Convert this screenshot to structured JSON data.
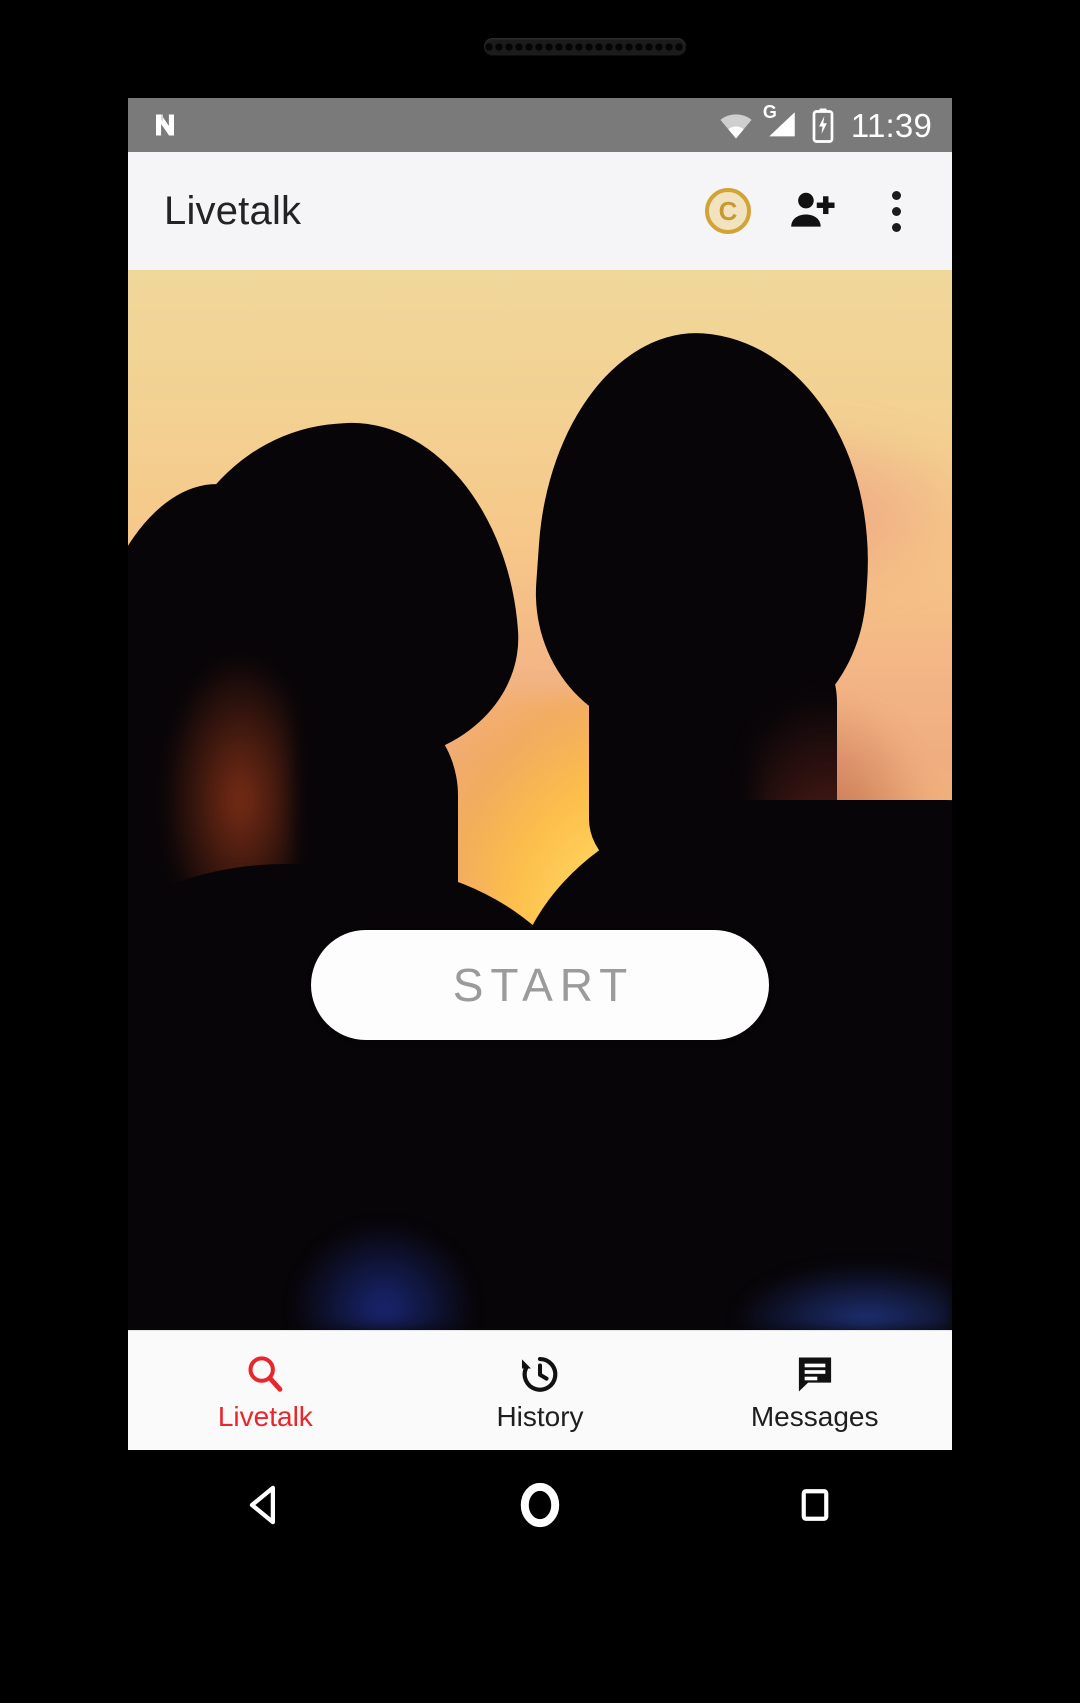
{
  "status_bar": {
    "notification_icon": "android-n-logo-icon",
    "wifi_icon": "wifi-icon",
    "network_label": "G",
    "signal_icon": "cellular-signal-icon",
    "battery_icon": "battery-charging-icon",
    "clock": "11:39",
    "background_color": "#7a7a7a"
  },
  "app_bar": {
    "title": "Livetalk",
    "background_color": "#f5f5f7",
    "actions": [
      {
        "name": "credits-coin-button",
        "icon": "coin-icon",
        "label": "C",
        "color": "#d2a437"
      },
      {
        "name": "add-friend-button",
        "icon": "person-add-icon",
        "label": ""
      },
      {
        "name": "overflow-menu-button",
        "icon": "more-vert-icon",
        "label": ""
      }
    ]
  },
  "hero": {
    "alt": "Silhouette of a couple touching foreheads at sunset",
    "sky_top_color": "#f0d79a",
    "sun_color": "#ffd45f",
    "silhouette_color": "#080508"
  },
  "start_button": {
    "label": "START",
    "text_color": "#9b9b9b",
    "background_color": "#fdfdfd"
  },
  "bottom_nav": {
    "active_color": "#e8262c",
    "inactive_color": "#1e1e1e",
    "items": [
      {
        "label": "Livetalk",
        "icon": "search-icon",
        "active": true
      },
      {
        "label": "History",
        "icon": "history-clock-icon",
        "active": false
      },
      {
        "label": "Messages",
        "icon": "chat-bubble-icon",
        "active": false
      }
    ]
  },
  "android_nav": {
    "back": "back-triangle-icon",
    "home": "home-circle-icon",
    "recents": "recents-square-icon"
  }
}
